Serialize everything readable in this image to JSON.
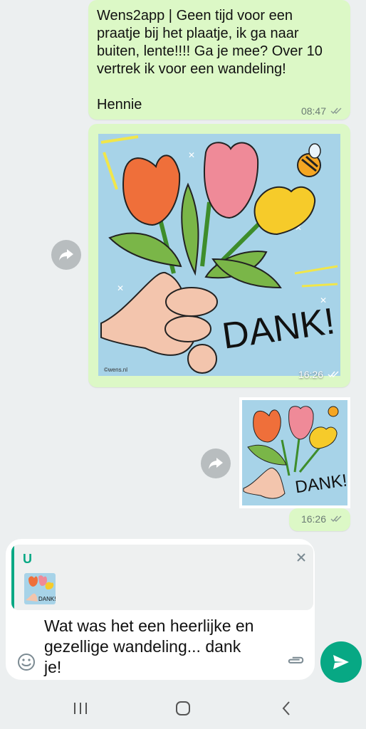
{
  "messages": [
    {
      "text": "Wens2app | Geen tijd voor een praatje bij het plaatje, ik ga naar buiten, lente!!!! Ga je mee? Over 10 vertrek ik voor een wandeling!\n\nHennie",
      "time": "08:47",
      "status": "read"
    },
    {
      "image": "thank-you-card",
      "card_text": "DANK!",
      "signature": "©wens.nl",
      "time": "16:26",
      "status": "read"
    },
    {
      "image": "thank-you-card-small",
      "card_text": "DANK!",
      "time": "16:26",
      "status": "read"
    }
  ],
  "composer": {
    "reply": {
      "name": "U",
      "thumb_text": "DANK!"
    },
    "text": "Wat was het een heerlijke en\ngezellige wandeling... dank\nje!"
  },
  "icons": {
    "forward": "forward-icon",
    "emoji": "emoji-icon",
    "attach": "paperclip-icon",
    "send": "send-icon",
    "close": "close-icon",
    "nav_recents": "recents-icon",
    "nav_home": "home-icon",
    "nav_back": "back-icon"
  },
  "colors": {
    "bubble": "#dcf8c6",
    "accent": "#07a884",
    "background": "#eceff0"
  }
}
